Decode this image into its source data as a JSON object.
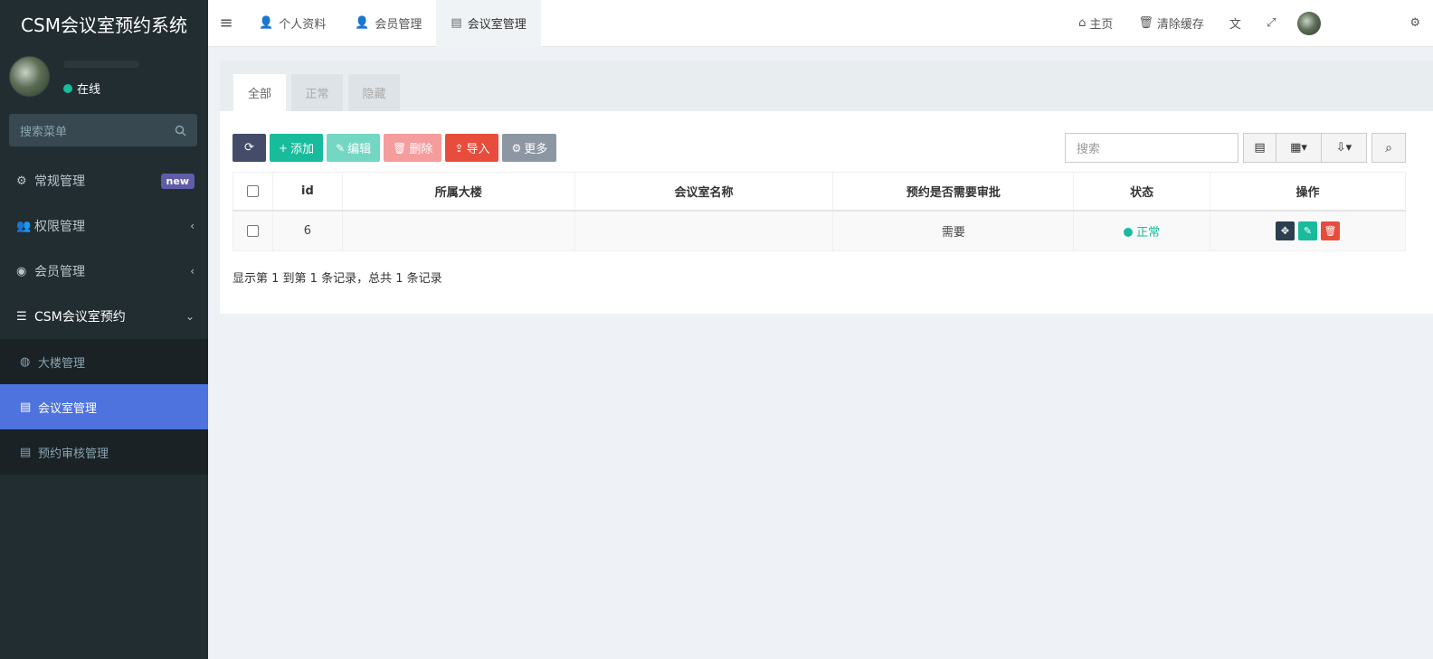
{
  "app": {
    "title": "CSM会议室预约系统"
  },
  "user": {
    "status": "在线"
  },
  "sidebar": {
    "search_placeholder": "搜索菜单",
    "items": [
      {
        "label": "常规管理",
        "badge": "new",
        "icon": "cogs-icon"
      },
      {
        "label": "权限管理",
        "chevron": "‹",
        "icon": "group-icon"
      },
      {
        "label": "会员管理",
        "chevron": "‹",
        "icon": "user-circle-icon"
      },
      {
        "label": "CSM会议室预约",
        "chevron": "⌄",
        "icon": "list-icon"
      }
    ],
    "sub_items": [
      {
        "label": "大楼管理",
        "icon": "building-icon"
      },
      {
        "label": "会议室管理",
        "icon": "file-icon",
        "active": true
      },
      {
        "label": "预约审核管理",
        "icon": "file-icon"
      }
    ]
  },
  "topnav": {
    "tabs": [
      {
        "label": "个人资料"
      },
      {
        "label": "会员管理"
      },
      {
        "label": "会议室管理",
        "active": true
      }
    ],
    "home": "主页",
    "clear_cache": "清除缓存"
  },
  "panel": {
    "tabs": [
      "全部",
      "正常",
      "隐藏"
    ],
    "toolbar": {
      "add": "添加",
      "edit": "编辑",
      "delete": "删除",
      "import": "导入",
      "more": "更多"
    },
    "search_placeholder": "搜索",
    "columns": [
      "id",
      "所属大楼",
      "会议室名称",
      "预约是否需要审批",
      "状态",
      "操作"
    ],
    "rows": [
      {
        "id": "6",
        "building": "",
        "room_name": "",
        "approval": "需要",
        "status": "正常"
      }
    ],
    "pagination_info": "显示第 1 到第 1 条记录，总共 1 条记录"
  },
  "colors": {
    "sidebar_bg": "#222d32",
    "accent": "#18bc9c",
    "active_menu": "#4e73df",
    "danger": "#e74c3c"
  }
}
